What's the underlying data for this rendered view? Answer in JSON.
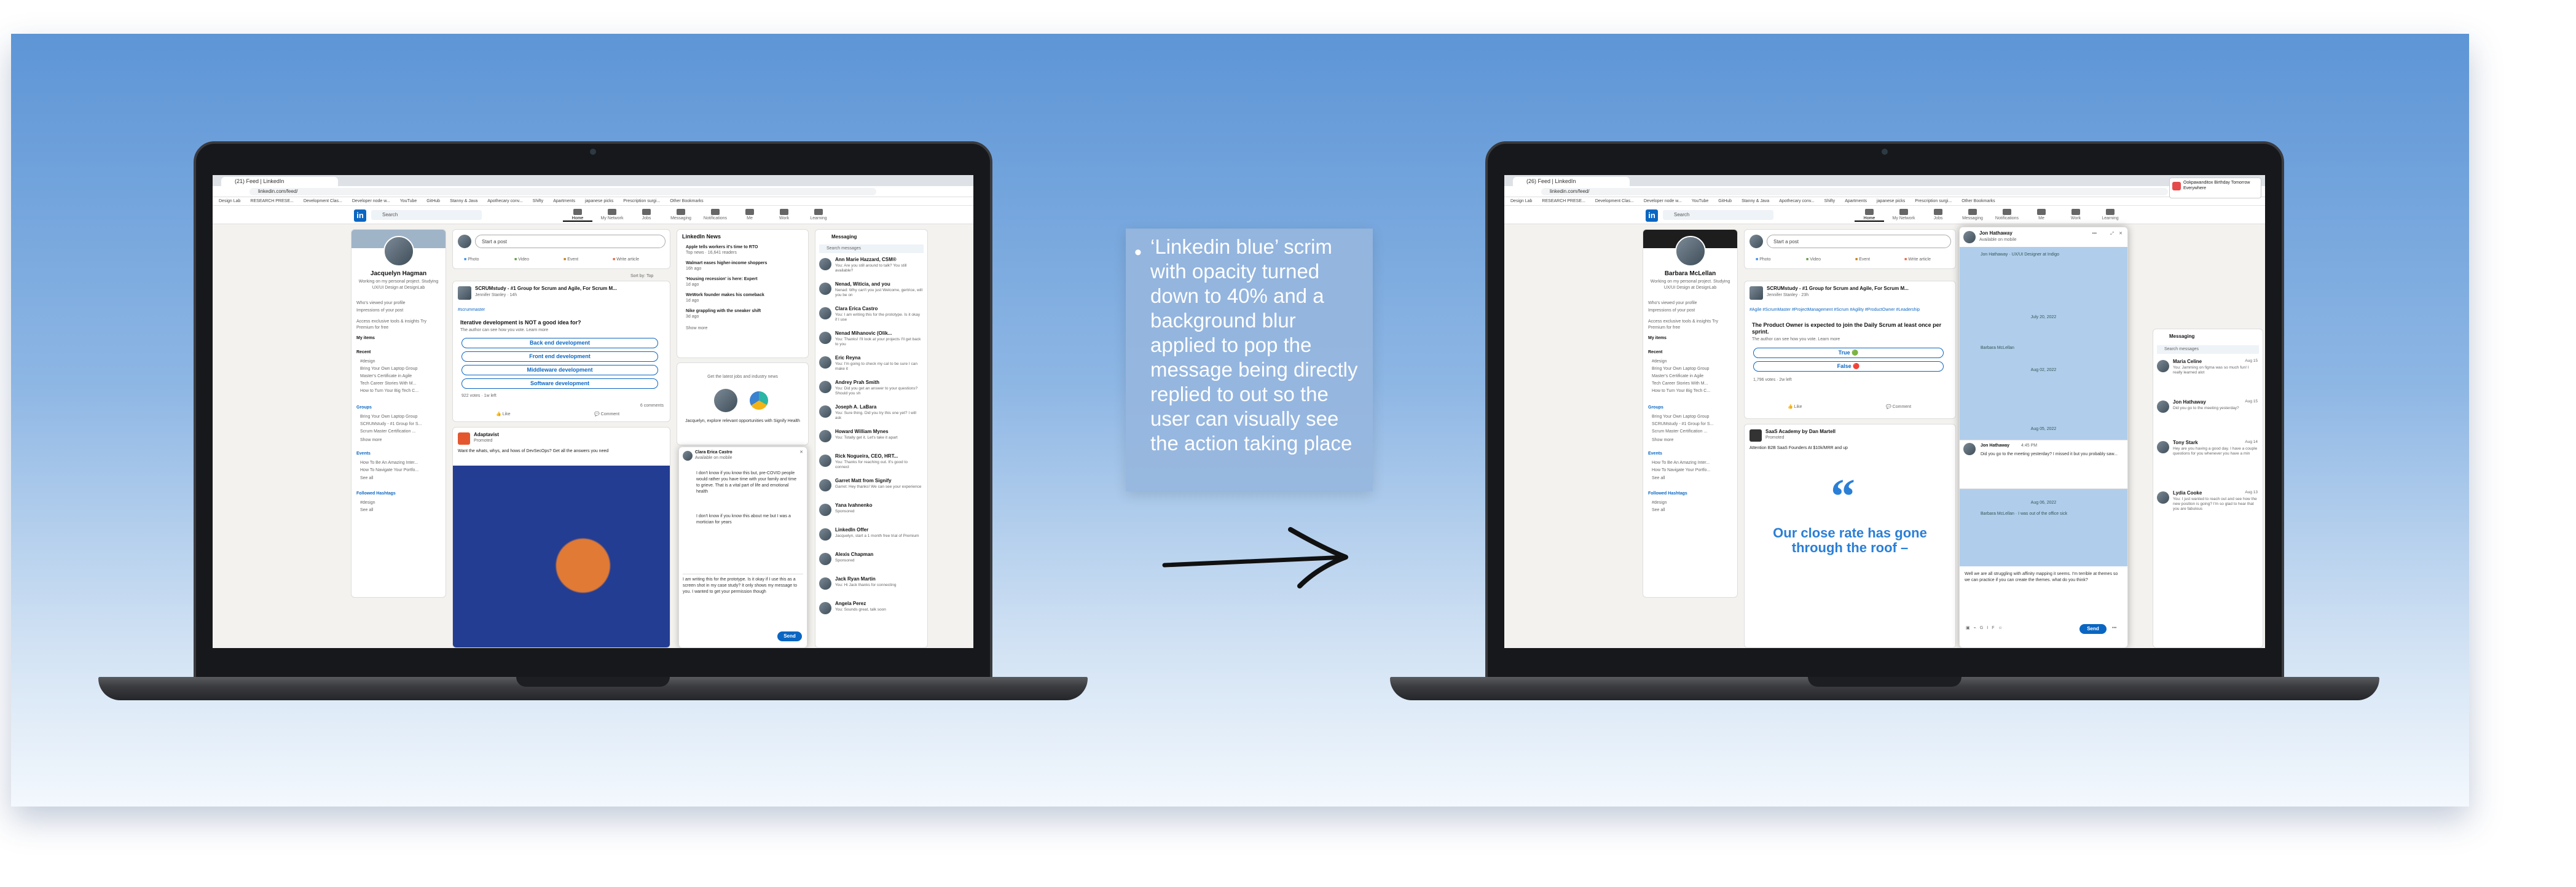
{
  "annotation": "‘Linkedin blue’ scrim with opacity turned down to 40% and a background blur applied to pop the message being directly replied to out so the user can visually see the action taking place",
  "colors": {
    "linkedin_blue": "#0a66c2",
    "background_top": "#5d95d6",
    "annotation_box": "#96b6de"
  },
  "bookmarks": [
    "Design Lab",
    "RESEARCH PRESE...",
    "Development Clas...",
    "Developer node w...",
    "YouTube",
    "GitHub",
    "Stanny & Java",
    "Apothecary conv...",
    "Shifty",
    "Apartments",
    "japanese picks",
    "Prescription surgi...",
    "Other Bookmarks"
  ],
  "nav": {
    "logo": "in",
    "search": "Search",
    "items": [
      "Home",
      "My Network",
      "Jobs",
      "Messaging",
      "Notifications",
      "Me",
      "Work",
      "Learning"
    ]
  },
  "feed": {
    "startpost": "Start a post",
    "actions": [
      "Photo",
      "Video",
      "Event",
      "Write article"
    ],
    "sortby": "Sort by: Top",
    "like": "Like",
    "comment": "Comment"
  },
  "messaging": {
    "title": "Messaging",
    "search": "Search messages"
  },
  "chat": {
    "send": "Send",
    "gif": "GIF"
  },
  "left": {
    "tab": "(21) Feed | LinkedIn",
    "url": "linkedin.com/feed/",
    "profile": {
      "name": "Jacquelyn Hagman",
      "headline": "Working on my personal project. Studying UX/UI Design at DesignLab",
      "views": "Who's viewed your profile",
      "impressions": "Impressions of your post",
      "premium": "Access exclusive tools & insights Try Premium for free",
      "myitems": "My items"
    },
    "side": {
      "recent": "Recent",
      "r0": "#design",
      "r1": "Bring Your Own Laptop Group",
      "r2": "Master's Certificate in Agile",
      "r3": "Tech Career Stories With M...",
      "r4": "How to Turn Your Big Tech C...",
      "groups": "Groups",
      "g0": "Bring Your Own Laptop Group",
      "g1": "SCRUMstudy - #1 Group for S...",
      "g2": "Scrum Master Certification ...",
      "showmore": "Show more",
      "events": "Events",
      "e0": "How To Be An Amazing Inter...",
      "e1": "How To Navigate Your Portfo...",
      "seeall": "See all",
      "hashtags": "Followed Hashtags",
      "h0": "#design"
    },
    "post": {
      "author": "SCRUMstudy - #1 Group for Scrum and Agile, For Scrum M...",
      "meta": "Jennifer Stanley · 14h",
      "hashtag": "#scrummaster",
      "question": "Iterative development is NOT a good idea for?",
      "note": "The author can see how you vote. Learn more",
      "options": [
        "Back end development",
        "Front end development",
        "Middleware development",
        "Software development"
      ],
      "votes": "922 votes · 1w left",
      "comments": "6 comments"
    },
    "ad": {
      "name": "Adaptavist",
      "promoted": "Promoted",
      "text": "Want the whats, whys, and hows of DevSecOps? Get all the answers you need"
    },
    "news": {
      "title": "LinkedIn News",
      "items": [
        "Apple tells workers it's time to RTO",
        "Walmart eases higher-income shoppers",
        "'Housing recession' is here: Expert",
        "WeWork founder makes his comeback",
        "Nike grappling with the sneaker shift"
      ],
      "meta": [
        "Top news · 16,641 readers",
        "16h ago",
        "1d ago",
        "1d ago",
        "3d ago"
      ],
      "showmore": "Show more"
    },
    "sidead": {
      "caption": "Get the latest jobs and industry news",
      "tagline": "Jacquelyn, explore relevant opportunities with Signify Health"
    },
    "chat": {
      "name": "Clara Erica Castro",
      "status": "Available on mobile",
      "msg1": "I don't know if you know this but, pre-COVID people would rather you have time with your family and time to grieve. That is a vital part of life and emotional health",
      "msg2": "I don't know if you know this about me but I was a mortician for years",
      "compose": "I am writing this for the prototype. Is it okay if I use this as a screen shot in my case study? It only shows my message to you. I wanted to get your permission though"
    },
    "msgs": [
      {
        "n": "Ann Marie Hazzard, CSM®",
        "p": "You: Are you still around to talk? You still available?"
      },
      {
        "n": "Nenad, Witicia, and you",
        "p": "Nenad: Why can't you just Welcome, gertrice, will you be on"
      },
      {
        "n": "Clara Erica Castro",
        "p": "You: I am writing this for the prototype. Is it okay if I use"
      },
      {
        "n": "Nenad Mihanovic (Olik...",
        "p": "You: Thanks! I'll look at your projects I'll get back to you"
      },
      {
        "n": "Eric Reyna",
        "p": "You: I'm going to check my cal to be sure I can make it"
      },
      {
        "n": "Andrey Prah Smith",
        "p": "You: Did you get an answer to your questions? Should you sh"
      },
      {
        "n": "Joseph A. LaBara",
        "p": "You: Sure thing. Did you try this one yet? I will ask"
      },
      {
        "n": "Howard William Mynes",
        "p": "You: Totally get it. Let's take it apart"
      },
      {
        "n": "Rick Nogueira, CEO, HRT...",
        "p": "You: Thanks for reaching out. It's good to connect"
      },
      {
        "n": "Garret Matt from Signify",
        "p": "Garret: Hey thanks! We can see your experience"
      },
      {
        "n": "Yana Ivahnenko",
        "p": "Sponsored"
      },
      {
        "n": "LinkedIn Offer",
        "p": "Jacquelyn, start a 1 month free trial of Premium"
      },
      {
        "n": "Alexis Chapman",
        "p": "Sponsored"
      },
      {
        "n": "Jack Ryan Martin",
        "p": "You: Hi Jack thanks for connecting"
      },
      {
        "n": "Angela Perez",
        "p": "You: Sounds great, talk soon"
      }
    ]
  },
  "right": {
    "tab": "(26) Feed | LinkedIn",
    "url": "linkedin.com/feed/",
    "toast": "Ookpawanditox Birthday Tomorrow Everywhere",
    "profile": {
      "name": "Barbara McLellan",
      "headline": "Working on my personal project. Studying UX/UI Design at DesignLab",
      "views": "Who's viewed your profile",
      "impressions": "Impressions of your post"
    },
    "post": {
      "meta": "Jennifer Stanley · 23h",
      "hashtags": "#Agile #ScrumMaster #ProjectManagement #Scrum #Agility #ProductOwner #Leadership",
      "question": "The Product Owner is expected to join the Daily Scrum at least once per sprint.",
      "options": [
        "True 🟢",
        "False 🔴"
      ],
      "votes": "1,796 votes · 2w left"
    },
    "ad": {
      "name": "SaaS Academy by Dan Martell",
      "text": "Attention B2B SaaS Founders At $10k/MRR and up",
      "headline": "Our close rate has gone through the roof –"
    },
    "chat": {
      "name": "Jon Hathaway",
      "status": "Available on mobile",
      "h1": "Jon Hathaway · UX/UI Designer at Indigo",
      "d1": "July 20, 2022",
      "h2": "Barbara McLellan",
      "d2": "Aug 02, 2022",
      "d3": "Aug 05, 2022",
      "t1": "4:45 PM",
      "highlight": "Did you go to the meeting yesterday? I missed it but you probably saw...",
      "d4": "Aug 06, 2022",
      "h3": "Barbara McLellan · I was out of the office sick",
      "compose": "Well we are all struggling with affinity mapping it seems. I'm terrible at themes so we can practice if you can create the themes. what do you think?"
    },
    "msgs": [
      {
        "n": "Maria Celine",
        "d": "Aug 15",
        "p": "You: Jamming on figma was so much fun! I really learned alot"
      },
      {
        "n": "Jon Hathaway",
        "d": "Aug 15",
        "p": "Did you go to the meeting yesterday?"
      },
      {
        "n": "Tony Stark",
        "d": "Aug 14",
        "p": "Hey are you having a good day. I have a couple questions for you whenever you have a min"
      },
      {
        "n": "Lydia Cooke",
        "d": "Aug 13",
        "p": "You: I just wanted to reach out and see how the new position is going? I'm so glad to hear that you are fabulous"
      }
    ]
  }
}
